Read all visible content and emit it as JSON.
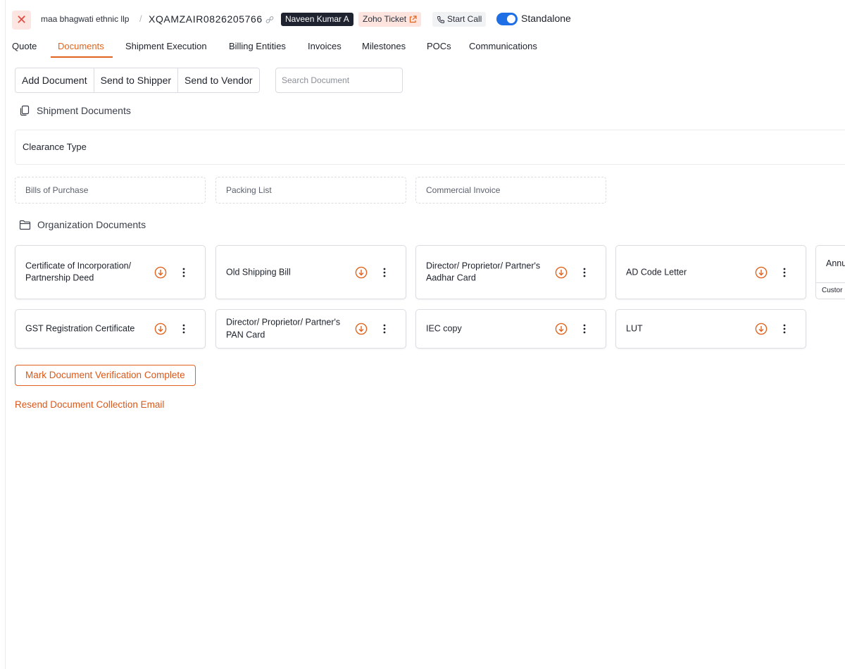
{
  "header": {
    "company": "maa bhagwati ethnic llp",
    "separator": "/",
    "shipment_id": "XQAMZAIR0826205766",
    "assignee": "Naveen Kumar A",
    "zoho_ticket": "Zoho Ticket",
    "start_call": "Start Call",
    "standalone_label": "Standalone",
    "standalone_on": true
  },
  "tabs": [
    {
      "label": "Quote",
      "active": false
    },
    {
      "label": "Documents",
      "active": true
    },
    {
      "label": "Shipment Execution",
      "active": false
    },
    {
      "label": "Billing Entities",
      "active": false
    },
    {
      "label": "Invoices",
      "active": false
    },
    {
      "label": "Milestones",
      "active": false
    },
    {
      "label": "POCs",
      "active": false
    },
    {
      "label": "Communications",
      "active": false
    }
  ],
  "toolbar": {
    "add_document": "Add Document",
    "send_to_shipper": "Send to Shipper",
    "send_to_vendor": "Send to Vendor",
    "search_placeholder": "Search Document"
  },
  "shipment_documents": {
    "title": "Shipment Documents",
    "clearance_type_label": "Clearance Type",
    "uploads": [
      "Bills of Purchase",
      "Packing List",
      "Commercial Invoice"
    ]
  },
  "organization_documents": {
    "title": "Organization Documents",
    "row1": [
      "Certificate of Incorporation/ Partnership Deed",
      "Old Shipping Bill",
      "Director/ Proprietor/ Partner's Aadhar Card",
      "AD Code Letter"
    ],
    "row2": [
      "GST Registration Certificate",
      "Director/ Proprietor/ Partner's PAN Card",
      "IEC copy",
      "LUT"
    ],
    "partial_card_title": "Annu",
    "partial_card_sub": "Custor"
  },
  "actions": {
    "mark_complete": "Mark Document Verification Complete",
    "resend_email": "Resend Document Collection Email"
  },
  "colors": {
    "accent": "#e0641f",
    "toggle": "#1e6ee6",
    "close": "#e14a3c"
  }
}
